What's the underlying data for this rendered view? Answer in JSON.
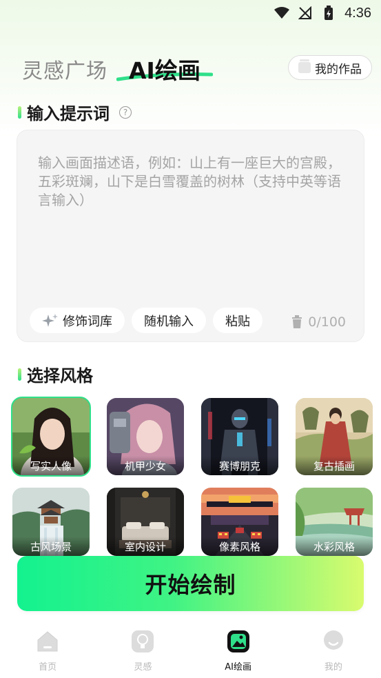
{
  "status_bar": {
    "time": "4:36",
    "icons": [
      "wifi-icon",
      "no-signal-icon",
      "battery-charging-icon"
    ]
  },
  "header": {
    "tab_inspiration": "灵感广场",
    "tab_ai_drawing": "AI绘画",
    "my_works_label": "我的作品",
    "accent_color": "#2fe08a"
  },
  "prompt_section": {
    "title": "输入提示词",
    "help_icon": "question-icon",
    "placeholder": "输入画面描述语，例如：山上有一座巨大的宫殿，五彩斑斓，山下是白雪覆盖的树林（支持中英等语言输入）",
    "actions": {
      "modifier_label": "修饰词库",
      "random_label": "随机输入",
      "paste_label": "粘贴"
    },
    "counter": "0/100"
  },
  "style_section": {
    "title": "选择风格",
    "styles": [
      {
        "label": "写实人像",
        "selected": true
      },
      {
        "label": "机甲少女",
        "selected": false
      },
      {
        "label": "赛博朋克",
        "selected": false
      },
      {
        "label": "复古插画",
        "selected": false
      },
      {
        "label": "古风场景",
        "selected": false
      },
      {
        "label": "室内设计",
        "selected": false
      },
      {
        "label": "像素风格",
        "selected": false
      },
      {
        "label": "水彩风格",
        "selected": false
      }
    ]
  },
  "start_button": {
    "label": "开始绘制"
  },
  "bottom_nav": {
    "items": [
      {
        "label": "首页",
        "icon": "home-icon",
        "active": false
      },
      {
        "label": "灵感",
        "icon": "lightbulb-icon",
        "active": false
      },
      {
        "label": "AI绘画",
        "icon": "image-icon",
        "active": true
      },
      {
        "label": "我的",
        "icon": "profile-icon",
        "active": false
      }
    ]
  }
}
